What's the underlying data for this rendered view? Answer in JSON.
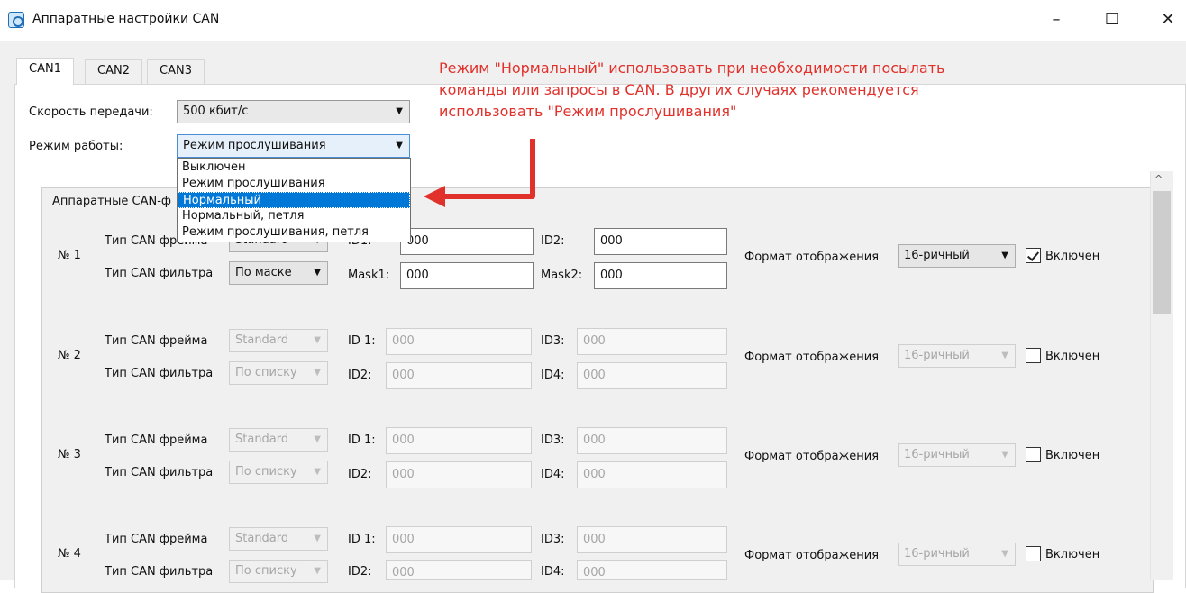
{
  "window": {
    "title": "Аппаратные настройки CAN",
    "minimize_glyph": "–",
    "maximize_glyph": "☐",
    "close_glyph": "✕"
  },
  "tabs": [
    {
      "label": "CAN1",
      "active": true
    },
    {
      "label": "CAN2",
      "active": false
    },
    {
      "label": "CAN3",
      "active": false
    }
  ],
  "settings": {
    "speed_label": "Скорость передачи:",
    "speed_value": "500 кбит/с",
    "mode_label": "Режим работы:",
    "mode_value": "Режим прослушивания"
  },
  "mode_dropdown": {
    "options": [
      "Выключен",
      "Режим прослушивания",
      "Нормальный",
      "Нормальный, петля",
      "Режим прослушивания, петля"
    ],
    "highlighted": "Нормальный"
  },
  "group_title": "Аппаратные CAN-ф",
  "filters": [
    {
      "number": "№ 1",
      "frame_label": "Тип CAN фрейма",
      "frame_value": "Standard",
      "filter_label": "Тип CAN фильтра",
      "filter_value": "По маске",
      "f1_label": "ID1:",
      "f1_value": "000",
      "f2_label": "ID2:",
      "f2_value": "000",
      "f3_label": "Mask1:",
      "f3_value": "000",
      "f4_label": "Mask2:",
      "f4_value": "000",
      "display_label": "Формат отображения",
      "display_value": "16-ричный",
      "enabled_label": "Включен",
      "enabled": true
    },
    {
      "number": "№ 2",
      "frame_label": "Тип CAN фрейма",
      "frame_value": "Standard",
      "filter_label": "Тип CAN фильтра",
      "filter_value": "По списку",
      "f1_label": "ID 1:",
      "f1_value": "000",
      "f2_label": "ID3:",
      "f2_value": "000",
      "f3_label": "ID2:",
      "f3_value": "000",
      "f4_label": "ID4:",
      "f4_value": "000",
      "display_label": "Формат отображения",
      "display_value": "16-ричный",
      "enabled_label": "Включен",
      "enabled": false
    },
    {
      "number": "№ 3",
      "frame_label": "Тип CAN фрейма",
      "frame_value": "Standard",
      "filter_label": "Тип CAN фильтра",
      "filter_value": "По списку",
      "f1_label": "ID 1:",
      "f1_value": "000",
      "f2_label": "ID3:",
      "f2_value": "000",
      "f3_label": "ID2:",
      "f3_value": "000",
      "f4_label": "ID4:",
      "f4_value": "000",
      "display_label": "Формат отображения",
      "display_value": "16-ричный",
      "enabled_label": "Включен",
      "enabled": false
    },
    {
      "number": "№ 4",
      "frame_label": "Тип CAN фрейма",
      "frame_value": "Standard",
      "filter_label": "Тип CAN фильтра",
      "filter_value": "По списку",
      "f1_label": "ID 1:",
      "f1_value": "000",
      "f2_label": "ID3:",
      "f2_value": "000",
      "f3_label": "ID2:",
      "f3_value": "000",
      "f4_label": "ID4:",
      "f4_value": "000",
      "display_label": "Формат отображения",
      "display_value": "16-ричный",
      "enabled_label": "Включен",
      "enabled": false
    }
  ],
  "annotation": {
    "lines": [
      "Режим \"Нормальный\" использовать при необходимости посылать",
      "команды или запросы в CAN. В других случаях рекомендуется",
      "использовать \"Режим прослушивания\""
    ],
    "color": "#e0312b"
  },
  "icons": {
    "app": "can-settings-app-icon",
    "combo_arrow": "▼",
    "scroll_up": "^"
  }
}
